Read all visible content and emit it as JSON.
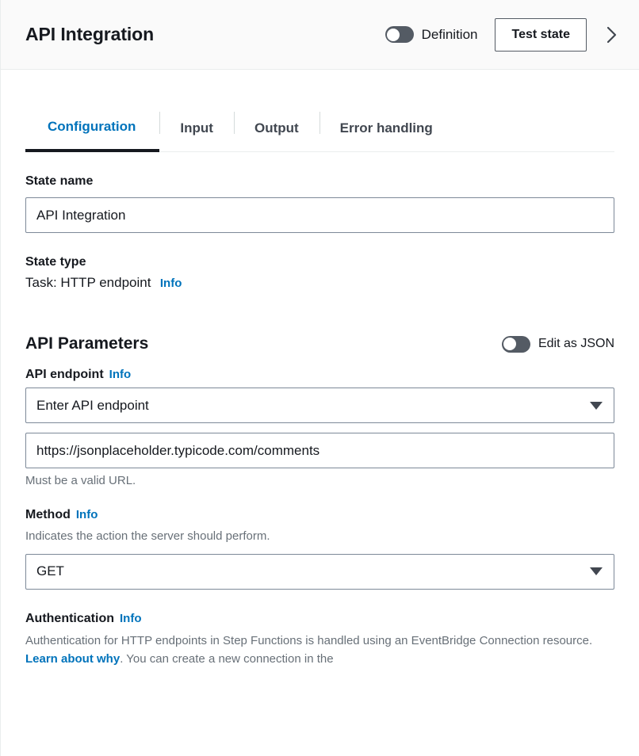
{
  "header": {
    "title": "API Integration",
    "definition_toggle": {
      "label": "Definition",
      "state": "off"
    },
    "test_state_button": "Test state",
    "collapse_icon": "chevron-right-icon"
  },
  "tabs": [
    {
      "label": "Configuration",
      "active": true
    },
    {
      "label": "Input",
      "active": false
    },
    {
      "label": "Output",
      "active": false
    },
    {
      "label": "Error handling",
      "active": false
    }
  ],
  "state_name": {
    "label": "State name",
    "value": "API Integration",
    "placeholder": "Enter state name"
  },
  "state_type": {
    "label": "State type",
    "value": "Task: HTTP endpoint",
    "info": "Info"
  },
  "api_parameters": {
    "title": "API Parameters",
    "edit_as_json_toggle": {
      "label": "Edit as JSON",
      "state": "off"
    },
    "api_endpoint": {
      "label": "API endpoint",
      "info": "Info",
      "select_value": "Enter API endpoint",
      "url_value": "https://jsonplaceholder.typicode.com/comments",
      "url_placeholder": "Enter API endpoint URL",
      "hint": "Must be a valid URL."
    },
    "method": {
      "label": "Method",
      "info": "Info",
      "description": "Indicates the action the server should perform.",
      "value": "GET"
    },
    "authentication": {
      "label": "Authentication",
      "info": "Info",
      "description_part1": "Authentication for HTTP endpoints in Step Functions is handled using an EventBridge Connection resource. ",
      "link_text": "Learn about why",
      "description_part2": ". You can create a new connection in the"
    }
  },
  "colors": {
    "accent_link": "#0073bb",
    "toggle_off": "#545b64",
    "header_bg": "#fafafa",
    "text_primary": "#16191f",
    "text_secondary": "#687078",
    "border": "#7d8998"
  }
}
